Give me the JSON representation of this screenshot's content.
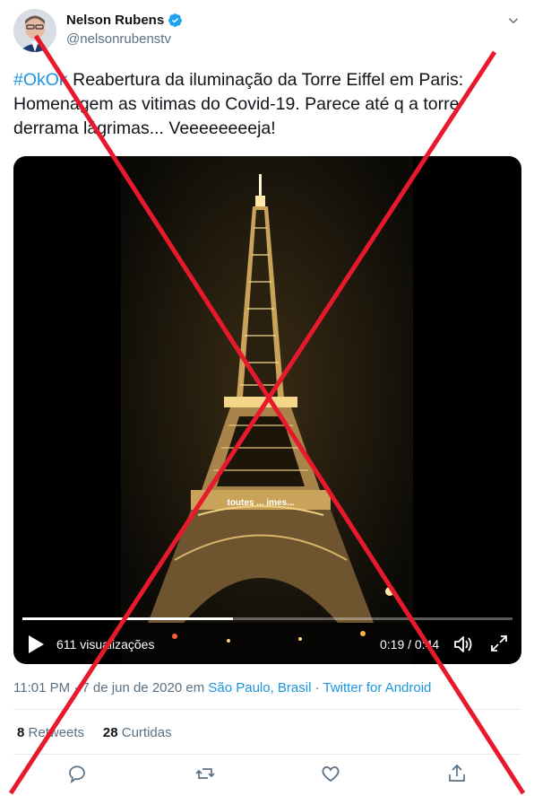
{
  "author": {
    "name": "Nelson Rubens",
    "handle": "@nelsonrubenstv",
    "verified": true
  },
  "tweet": {
    "hashtag": "#OkOk",
    "text": " Reabertura da iluminação da Torre Eiffel em Paris: Homenagem as vitimas do Covid-19. Parece até q a torre derrama lágrimas... Veeeeeeeeja!"
  },
  "video": {
    "views": "611 visualizações",
    "time": "0:19 / 0:44",
    "progress": 0.43,
    "overlay_text": "toutes ... imes..."
  },
  "meta": {
    "time": "11:01 PM · 7 de jun de 2020 em ",
    "location": "São Paulo, Brasil",
    "sep": " · ",
    "source": "Twitter for Android"
  },
  "stats": {
    "retweets_count": "8",
    "retweets_label": "Retweets",
    "likes_count": "28",
    "likes_label": "Curtidas"
  },
  "colors": {
    "link": "#1b95e0",
    "muted": "#5b7083",
    "cross": "#e8192c"
  },
  "icons": [
    "verified-badge-icon",
    "chevron-down-icon",
    "play-icon",
    "volume-icon",
    "fullscreen-icon",
    "reply-icon",
    "retweet-icon",
    "like-icon",
    "share-icon"
  ]
}
